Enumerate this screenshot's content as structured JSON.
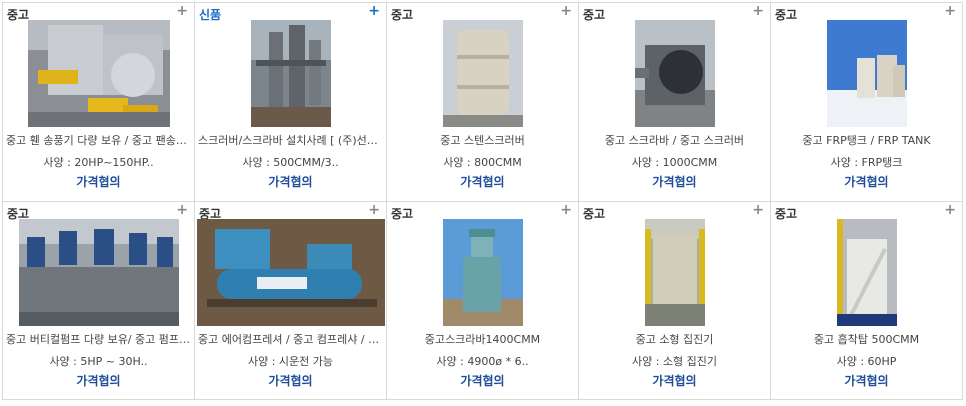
{
  "products": [
    {
      "badge": "중고",
      "is_new": false,
      "title": "중고 휀 송풍기 다량 보유 / 중고 팬송풍…",
      "spec": "사양 : 20HP~150HP..",
      "price": "가격협의",
      "image_icon": "industrial-fan-photo"
    },
    {
      "badge": "신품",
      "is_new": true,
      "title": "스크러버/스크라바 설치사례 [ (주)선영 ]",
      "spec": "사양 : 500CMM/3..",
      "price": "가격협의",
      "image_icon": "scrubber-installation-photo"
    },
    {
      "badge": "중고",
      "is_new": false,
      "title": "중고 스텐스크러버",
      "spec": "사양 : 800CMM",
      "price": "가격협의",
      "image_icon": "stainless-scrubber-photo"
    },
    {
      "badge": "중고",
      "is_new": false,
      "title": "중고 스크라바 / 중고 스크러버",
      "spec": "사양 : 1000CMM",
      "price": "가격협의",
      "image_icon": "scrubber-photo"
    },
    {
      "badge": "중고",
      "is_new": false,
      "title": "중고 FRP탱크 / FRP TANK",
      "spec": "사양 : FRP탱크",
      "price": "가격협의",
      "image_icon": "frp-tank-photo"
    },
    {
      "badge": "중고",
      "is_new": false,
      "title": "중고 버티컬펌프 다량 보유/ 중고 펌프/…",
      "spec": "사양 : 5HP ~ 30H..",
      "price": "가격협의",
      "image_icon": "vertical-pump-photo"
    },
    {
      "badge": "중고",
      "is_new": false,
      "title": "중고 에어컴프레셔 / 중고 컴프레샤 / 중…",
      "spec": "사양 : 시운전 가능",
      "price": "가격협의",
      "image_icon": "air-compressor-photo"
    },
    {
      "badge": "중고",
      "is_new": false,
      "title": "중고스크라바1400CMM",
      "spec": "사양 : 4900ø * 6..",
      "price": "가격협의",
      "image_icon": "scrubber-tower-photo"
    },
    {
      "badge": "중고",
      "is_new": false,
      "title": "중고 소형 집진기",
      "spec": "사양 : 소형 집진기",
      "price": "가격협의",
      "image_icon": "dust-collector-photo"
    },
    {
      "badge": "중고",
      "is_new": false,
      "title": "중고 흡착탑 500CMM",
      "spec": "사양 : 60HP",
      "price": "가격협의",
      "image_icon": "adsorption-tower-photo"
    }
  ],
  "add_icon": "+",
  "colors": {
    "accent_blue": "#1a6fc4",
    "price_blue": "#1f4e9a",
    "border": "#d9d9d9"
  }
}
